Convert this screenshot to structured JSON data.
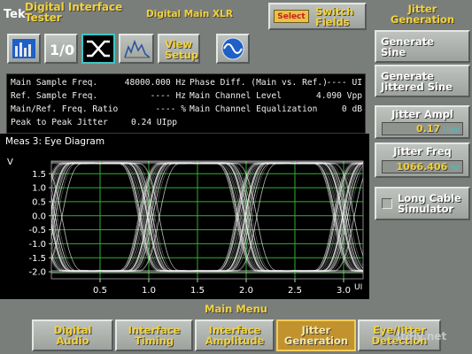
{
  "header": {
    "brand": "Tek",
    "title_line1": "Digital Interface",
    "title_line2": "Tester",
    "mode": "Digital Main XLR",
    "select_label": "Select",
    "switch_line1": "Switch",
    "switch_line2": "Fields"
  },
  "toolbar": {
    "io_label": "1/0",
    "view_setup_line1": "View",
    "view_setup_line2": "Setup"
  },
  "measurements": {
    "left": [
      {
        "label": "Main Sample Freq.",
        "value": "48000.000 Hz"
      },
      {
        "label": "Ref. Sample Freq.",
        "value": "---- Hz"
      },
      {
        "label": "Main/Ref. Freq. Ratio",
        "value": "---- %"
      },
      {
        "label": "Peak to Peak Jitter",
        "value": "0.24 UIpp"
      }
    ],
    "right": [
      {
        "label": "Phase Diff. (Main vs. Ref.)",
        "value": "---- UI"
      },
      {
        "label": "Main Channel Level",
        "value": "4.090 Vpp"
      },
      {
        "label": "Main Channel Equalization",
        "value": "0 dB"
      }
    ]
  },
  "plot": {
    "title": "Meas 3: Eye Diagram",
    "y_unit": "V",
    "x_unit": "UI"
  },
  "chart_data": {
    "type": "line",
    "title": "Meas 3: Eye Diagram",
    "ylabel": "V",
    "xlabel": "UI",
    "x_ticks": [
      "0.5",
      "1.0",
      "1.5",
      "2.0",
      "2.5",
      "3.0"
    ],
    "y_ticks": [
      "1.5",
      "1.0",
      "0.5",
      "0.0",
      "-0.5",
      "-1.0",
      "-1.5",
      "-2.0"
    ],
    "xlim": [
      0,
      3.2
    ],
    "ylim": [
      -2.25,
      1.95
    ],
    "grid": true,
    "eye_levels_v": {
      "high": 1.9,
      "low": -2.0
    },
    "crossing_centers_ui": [
      0.0,
      1.0,
      2.0,
      3.0
    ],
    "trace_color": "#f0f0f0",
    "grid_color": "#2fb12f"
  },
  "side_panel": {
    "title_line1": "Jitter",
    "title_line2": "Generation",
    "gen_sine_line1": "Generate",
    "gen_sine_line2": "Sine",
    "gen_jit_line1": "Generate",
    "gen_jit_line2": "Jittered Sine",
    "jitter_ampl_label": "Jitter Ampl",
    "jitter_ampl_value": "0.17",
    "jitter_ampl_unit": "UIpp",
    "jitter_freq_label": "Jitter Freq",
    "jitter_freq_value": "1066.406",
    "jitter_freq_unit": "Hz",
    "long_cable_line1": "Long Cable",
    "long_cable_line2": "Simulator"
  },
  "main_menu": {
    "title": "Main Menu",
    "items": [
      {
        "line1": "Digital",
        "line2": "Audio"
      },
      {
        "line1": "Interface",
        "line2": "Timing"
      },
      {
        "line1": "Interface",
        "line2": "Amplitude"
      },
      {
        "line1": "Jitter",
        "line2": "Generation"
      },
      {
        "line1": "Eye/Jitter",
        "line2": "Detection"
      }
    ]
  },
  "watermark": "itdiy.net",
  "colors": {
    "accent": "#f2d23a",
    "grid": "#2fb12f",
    "selected_menu": "#c2922f",
    "panel_bg": "#000000"
  }
}
